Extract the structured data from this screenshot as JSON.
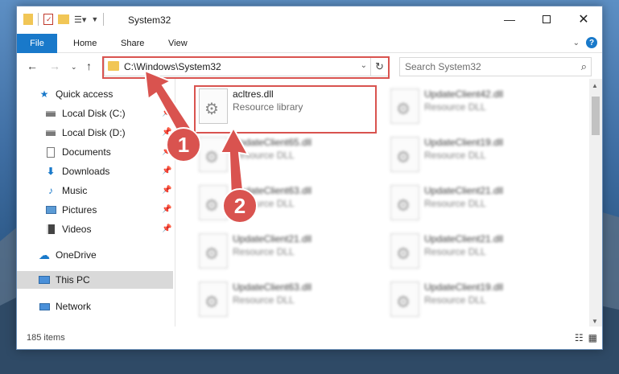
{
  "window": {
    "title": "System32"
  },
  "ribbon": {
    "tabs": [
      "File",
      "Home",
      "Share",
      "View"
    ]
  },
  "address": {
    "path": "C:\\Windows\\System32"
  },
  "search": {
    "placeholder": "Search System32"
  },
  "sidebar": {
    "items": [
      {
        "label": "Quick access",
        "icon": "star-icon",
        "pinned": false
      },
      {
        "label": "Local Disk (C:)",
        "icon": "drive-icon",
        "pinned": true
      },
      {
        "label": "Local Disk (D:)",
        "icon": "drive-icon",
        "pinned": true
      },
      {
        "label": "Documents",
        "icon": "document-icon",
        "pinned": true
      },
      {
        "label": "Downloads",
        "icon": "download-icon",
        "pinned": true
      },
      {
        "label": "Music",
        "icon": "music-icon",
        "pinned": true
      },
      {
        "label": "Pictures",
        "icon": "pictures-icon",
        "pinned": true
      },
      {
        "label": "Videos",
        "icon": "video-icon",
        "pinned": true
      },
      {
        "label": "OneDrive",
        "icon": "cloud-icon",
        "pinned": false
      },
      {
        "label": "This PC",
        "icon": "computer-icon",
        "pinned": false,
        "selected": true
      },
      {
        "label": "Network",
        "icon": "network-icon",
        "pinned": false
      }
    ]
  },
  "files": [
    {
      "name": "acltres.dll",
      "type": "Resource library",
      "highlighted": true
    },
    {
      "name": "UpdateClient42.dll",
      "type": "Resource DLL"
    },
    {
      "name": "UpdateClient65.dll",
      "type": "Resource DLL"
    },
    {
      "name": "UpdateClient19.dll",
      "type": "Resource DLL"
    },
    {
      "name": "UpdateClient63.dll",
      "type": "Resource DLL"
    },
    {
      "name": "UpdateClient21.dll",
      "type": "Resource DLL"
    },
    {
      "name": "UpdateClient21.dll",
      "type": "Resource DLL"
    },
    {
      "name": "UpdateClient21.dll",
      "type": "Resource DLL"
    },
    {
      "name": "UpdateClient63.dll",
      "type": "Resource DLL"
    },
    {
      "name": "UpdateClient19.dll",
      "type": "Resource DLL"
    }
  ],
  "status": {
    "items": "185 items"
  },
  "annotations": {
    "step1": "1",
    "step2": "2"
  },
  "colors": {
    "accent": "#1979ca",
    "annotation": "#d9534f"
  }
}
